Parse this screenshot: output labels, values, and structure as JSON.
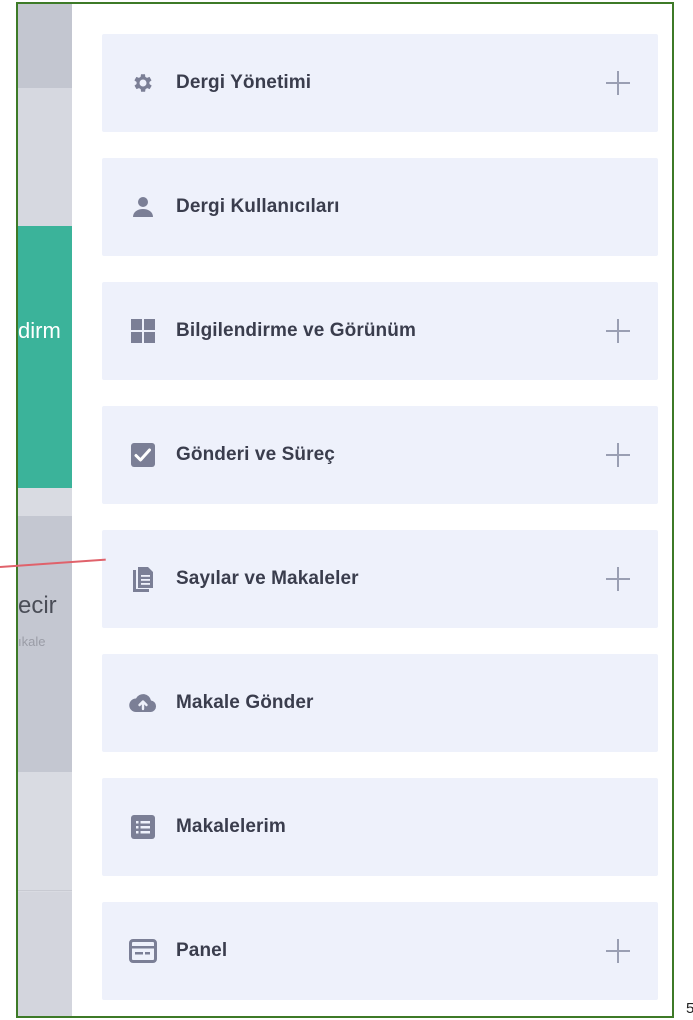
{
  "background": {
    "teal_text": "dirm",
    "gray_text": "ecir",
    "small_text": "ıkale"
  },
  "menu": [
    {
      "label": "Dergi Yönetimi",
      "icon": "gear-icon",
      "expandable": true
    },
    {
      "label": "Dergi Kullanıcıları",
      "icon": "user-icon",
      "expandable": false
    },
    {
      "label": "Bilgilendirme ve Görünüm",
      "icon": "grid-icon",
      "expandable": true
    },
    {
      "label": "Gönderi ve Süreç",
      "icon": "checkbox-icon",
      "expandable": true
    },
    {
      "label": "Sayılar ve Makaleler",
      "icon": "documents-icon",
      "expandable": true
    },
    {
      "label": "Makale Gönder",
      "icon": "cloud-upload-icon",
      "expandable": false
    },
    {
      "label": "Makalelerim",
      "icon": "list-icon",
      "expandable": false
    },
    {
      "label": "Panel",
      "icon": "window-icon",
      "expandable": true
    }
  ],
  "colors": {
    "item_bg": "#eef1fb",
    "icon": "#7b7f96",
    "text": "#3a3d4d",
    "teal": "#3bb39a",
    "frame": "#3d7a27",
    "pointer": "#e0626b"
  },
  "page_number": "5"
}
